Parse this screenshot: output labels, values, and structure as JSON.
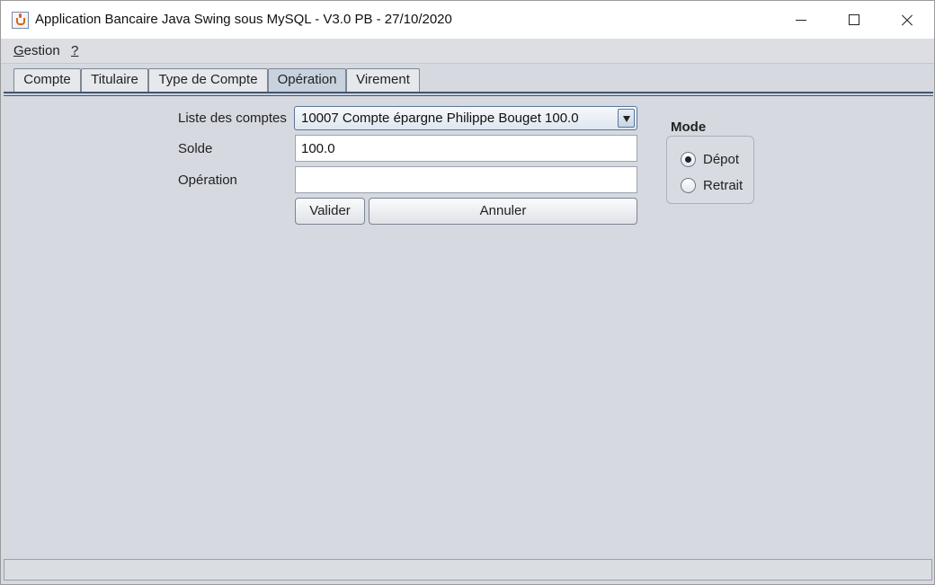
{
  "window": {
    "title": "Application Bancaire Java Swing sous MySQL - V3.0 PB - 27/10/2020"
  },
  "menu": {
    "gestion_rest": "estion",
    "gestion_mnemonic": "G",
    "help": "?"
  },
  "tabs": [
    {
      "label": "Compte",
      "selected": false
    },
    {
      "label": "Titulaire",
      "selected": false
    },
    {
      "label": "Type de Compte",
      "selected": false
    },
    {
      "label": "Opération",
      "selected": true
    },
    {
      "label": "Virement",
      "selected": false
    }
  ],
  "form": {
    "liste_label": "Liste des comptes",
    "liste_value": "10007 Compte épargne Philippe Bouget 100.0",
    "solde_label": "Solde",
    "solde_value": "100.0",
    "operation_label": "Opération",
    "operation_value": "",
    "valider_label": "Valider",
    "annuler_label": "Annuler"
  },
  "mode": {
    "title": "Mode",
    "options": [
      {
        "label": "Dépot",
        "selected": true
      },
      {
        "label": "Retrait",
        "selected": false
      }
    ]
  },
  "icons": {
    "app": "java-cup-icon",
    "minimize": "minimize-icon",
    "maximize": "maximize-icon",
    "close": "close-icon",
    "dropdown": "dropdown-arrow-icon"
  }
}
